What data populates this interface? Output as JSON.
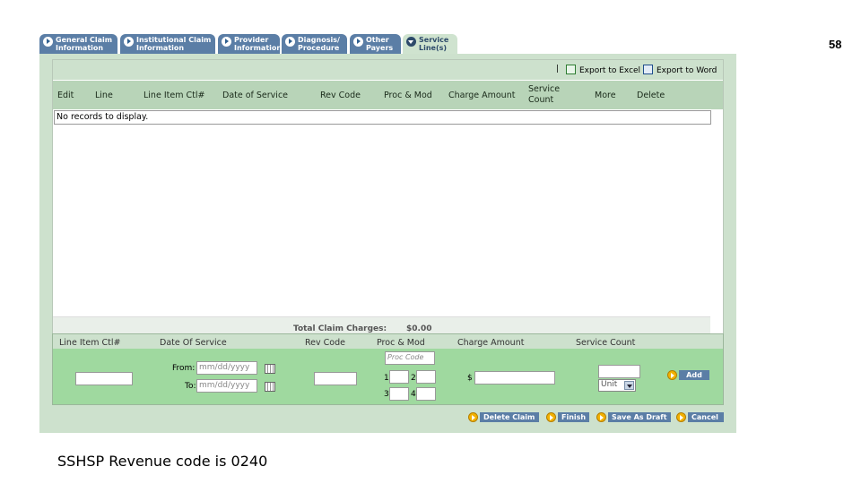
{
  "slide": {
    "number": "58",
    "caption": "SSHSP Revenue code is 0240"
  },
  "tabs": [
    {
      "line1": "General Claim",
      "line2": "Information"
    },
    {
      "line1": "Institutional Claim",
      "line2": "Information"
    },
    {
      "line1": "Provider",
      "line2": "Information"
    },
    {
      "line1": "Diagnosis/",
      "line2": "Procedure"
    },
    {
      "line1": "Other",
      "line2": "Payers"
    },
    {
      "line1": "Service",
      "line2": "Line(s)"
    }
  ],
  "toolbar": {
    "separator": "|",
    "export_excel": "Export to Excel",
    "export_word": "Export to Word"
  },
  "grid": {
    "columns": [
      "Edit",
      "Line",
      "Line Item Ctl#",
      "Date of Service",
      "Rev Code",
      "Proc & Mod",
      "Charge Amount",
      "Service",
      "Count",
      "More",
      "Delete"
    ],
    "empty_message": "No records to display.",
    "total_label": "Total Claim Charges:",
    "total_value": "$0.00"
  },
  "entry": {
    "headers": [
      "Line Item Ctl#",
      "Date Of Service",
      "Rev Code",
      "Proc & Mod",
      "Charge Amount",
      "Service Count"
    ],
    "from_label": "From:",
    "to_label": "To:",
    "date_placeholder": "mm/dd/yyyy",
    "proc_placeholder": "Proc Code",
    "mod_labels": [
      "1",
      "2",
      "3",
      "4"
    ],
    "dollar": "$",
    "unit_selected": "Unit",
    "add_label": "Add"
  },
  "actions": {
    "delete_claim": "Delete Claim",
    "finish": "Finish",
    "save_draft": "Save As Draft",
    "cancel": "Cancel"
  }
}
